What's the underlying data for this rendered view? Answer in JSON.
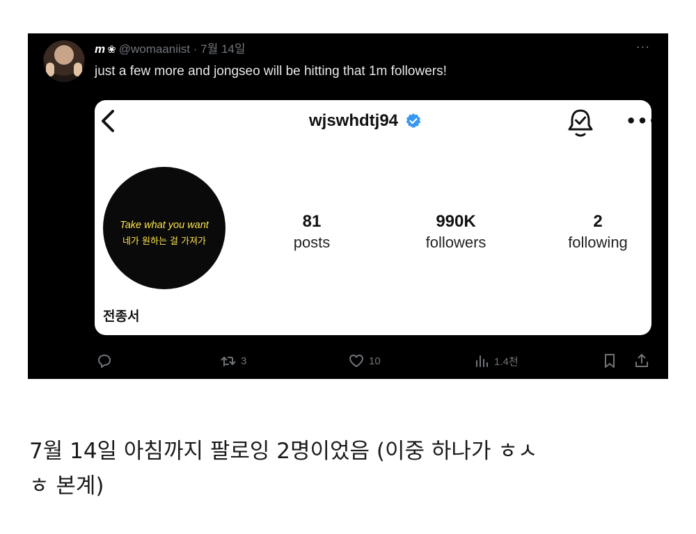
{
  "tweet": {
    "author_name": "m",
    "author_handle": "@womaaniist",
    "separator": "·",
    "date": "7월 14일",
    "more_label": "···",
    "text": "just a few more and jongseo will be hitting that 1m followers!",
    "icons": {
      "name_badge": "flower-icon",
      "more": "ellipsis-icon"
    }
  },
  "card": {
    "username": "wjswhdtj94",
    "verified_color": "#3897f0",
    "more_label": "•••",
    "profile_pic_line1": "Take what you want",
    "profile_pic_line2": "네가 원하는 걸 가져가",
    "stats": [
      {
        "value": "81",
        "label": "posts"
      },
      {
        "value": "990K",
        "label": "followers"
      },
      {
        "value": "2",
        "label": "following"
      }
    ],
    "display_name": "전종서"
  },
  "actions": {
    "retweets": "3",
    "likes": "10",
    "views": "1.4천"
  },
  "caption": {
    "line1": "7월 14일 아침까지 팔로잉 2명이었음 (이중 하나가 ㅎㅅ",
    "line2": "ㅎ 본계)"
  }
}
